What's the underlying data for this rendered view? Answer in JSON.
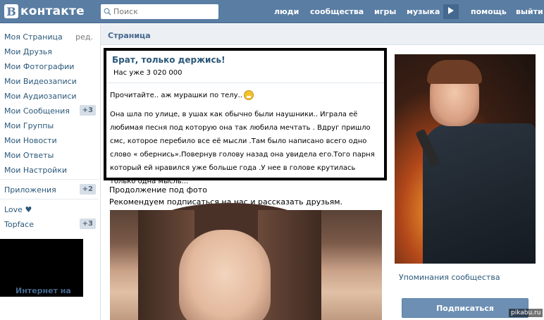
{
  "header": {
    "logo_letter": "B",
    "logo_text": "контакте",
    "search_placeholder": "Поиск",
    "nav": [
      "люди",
      "сообщества",
      "игры",
      "музыка",
      "помощь",
      "выйти"
    ]
  },
  "sidebar": {
    "items": [
      {
        "label": "Моя Страница",
        "aside": "ред."
      },
      {
        "label": "Мои Друзья"
      },
      {
        "label": "Мои Фотографии"
      },
      {
        "label": "Мои Видеозаписи"
      },
      {
        "label": "Мои Аудиозаписи"
      },
      {
        "label": "Мои Сообщения",
        "badge": "+3"
      },
      {
        "label": "Мои Группы"
      },
      {
        "label": "Мои Новости"
      },
      {
        "label": "Мои Ответы"
      },
      {
        "label": "Мои Настройки"
      },
      {
        "label": "Приложения",
        "badge": "+2"
      },
      {
        "label": "Love ♥"
      },
      {
        "label": "Topface",
        "badge": "+3"
      }
    ],
    "footer_text": "Интернет на"
  },
  "page": {
    "title": "Страница",
    "post": {
      "title": "Брат, только держись!",
      "subtitle": "Нас уже 3 020 000",
      "line1": "Прочитайте.. аж мурашки по телу..",
      "body": "Она шла по улице, в ушах как обычно были наушники.. Играла её любимая песня под которую она так любила мечтать . Вдруг пришло смс, которое перебило все её мысли .Там было написано всего одно слово « обернись».Повернув голову назад она увидела его.Того парня который ей нравился уже больше года .У нее в голове крутилась только одна мысль..."
    },
    "continuation": "Продолжение под фото",
    "recommend": "Рекомендуем подписаться на нас и рассказать друзьям."
  },
  "right": {
    "mention": "Упоминания сообщества",
    "subscribe": "Подписаться"
  },
  "watermark": "pikabu.ru",
  "colors": {
    "brand": "#597da3",
    "link": "#2b587a",
    "badge_bg": "#d6dee7"
  }
}
